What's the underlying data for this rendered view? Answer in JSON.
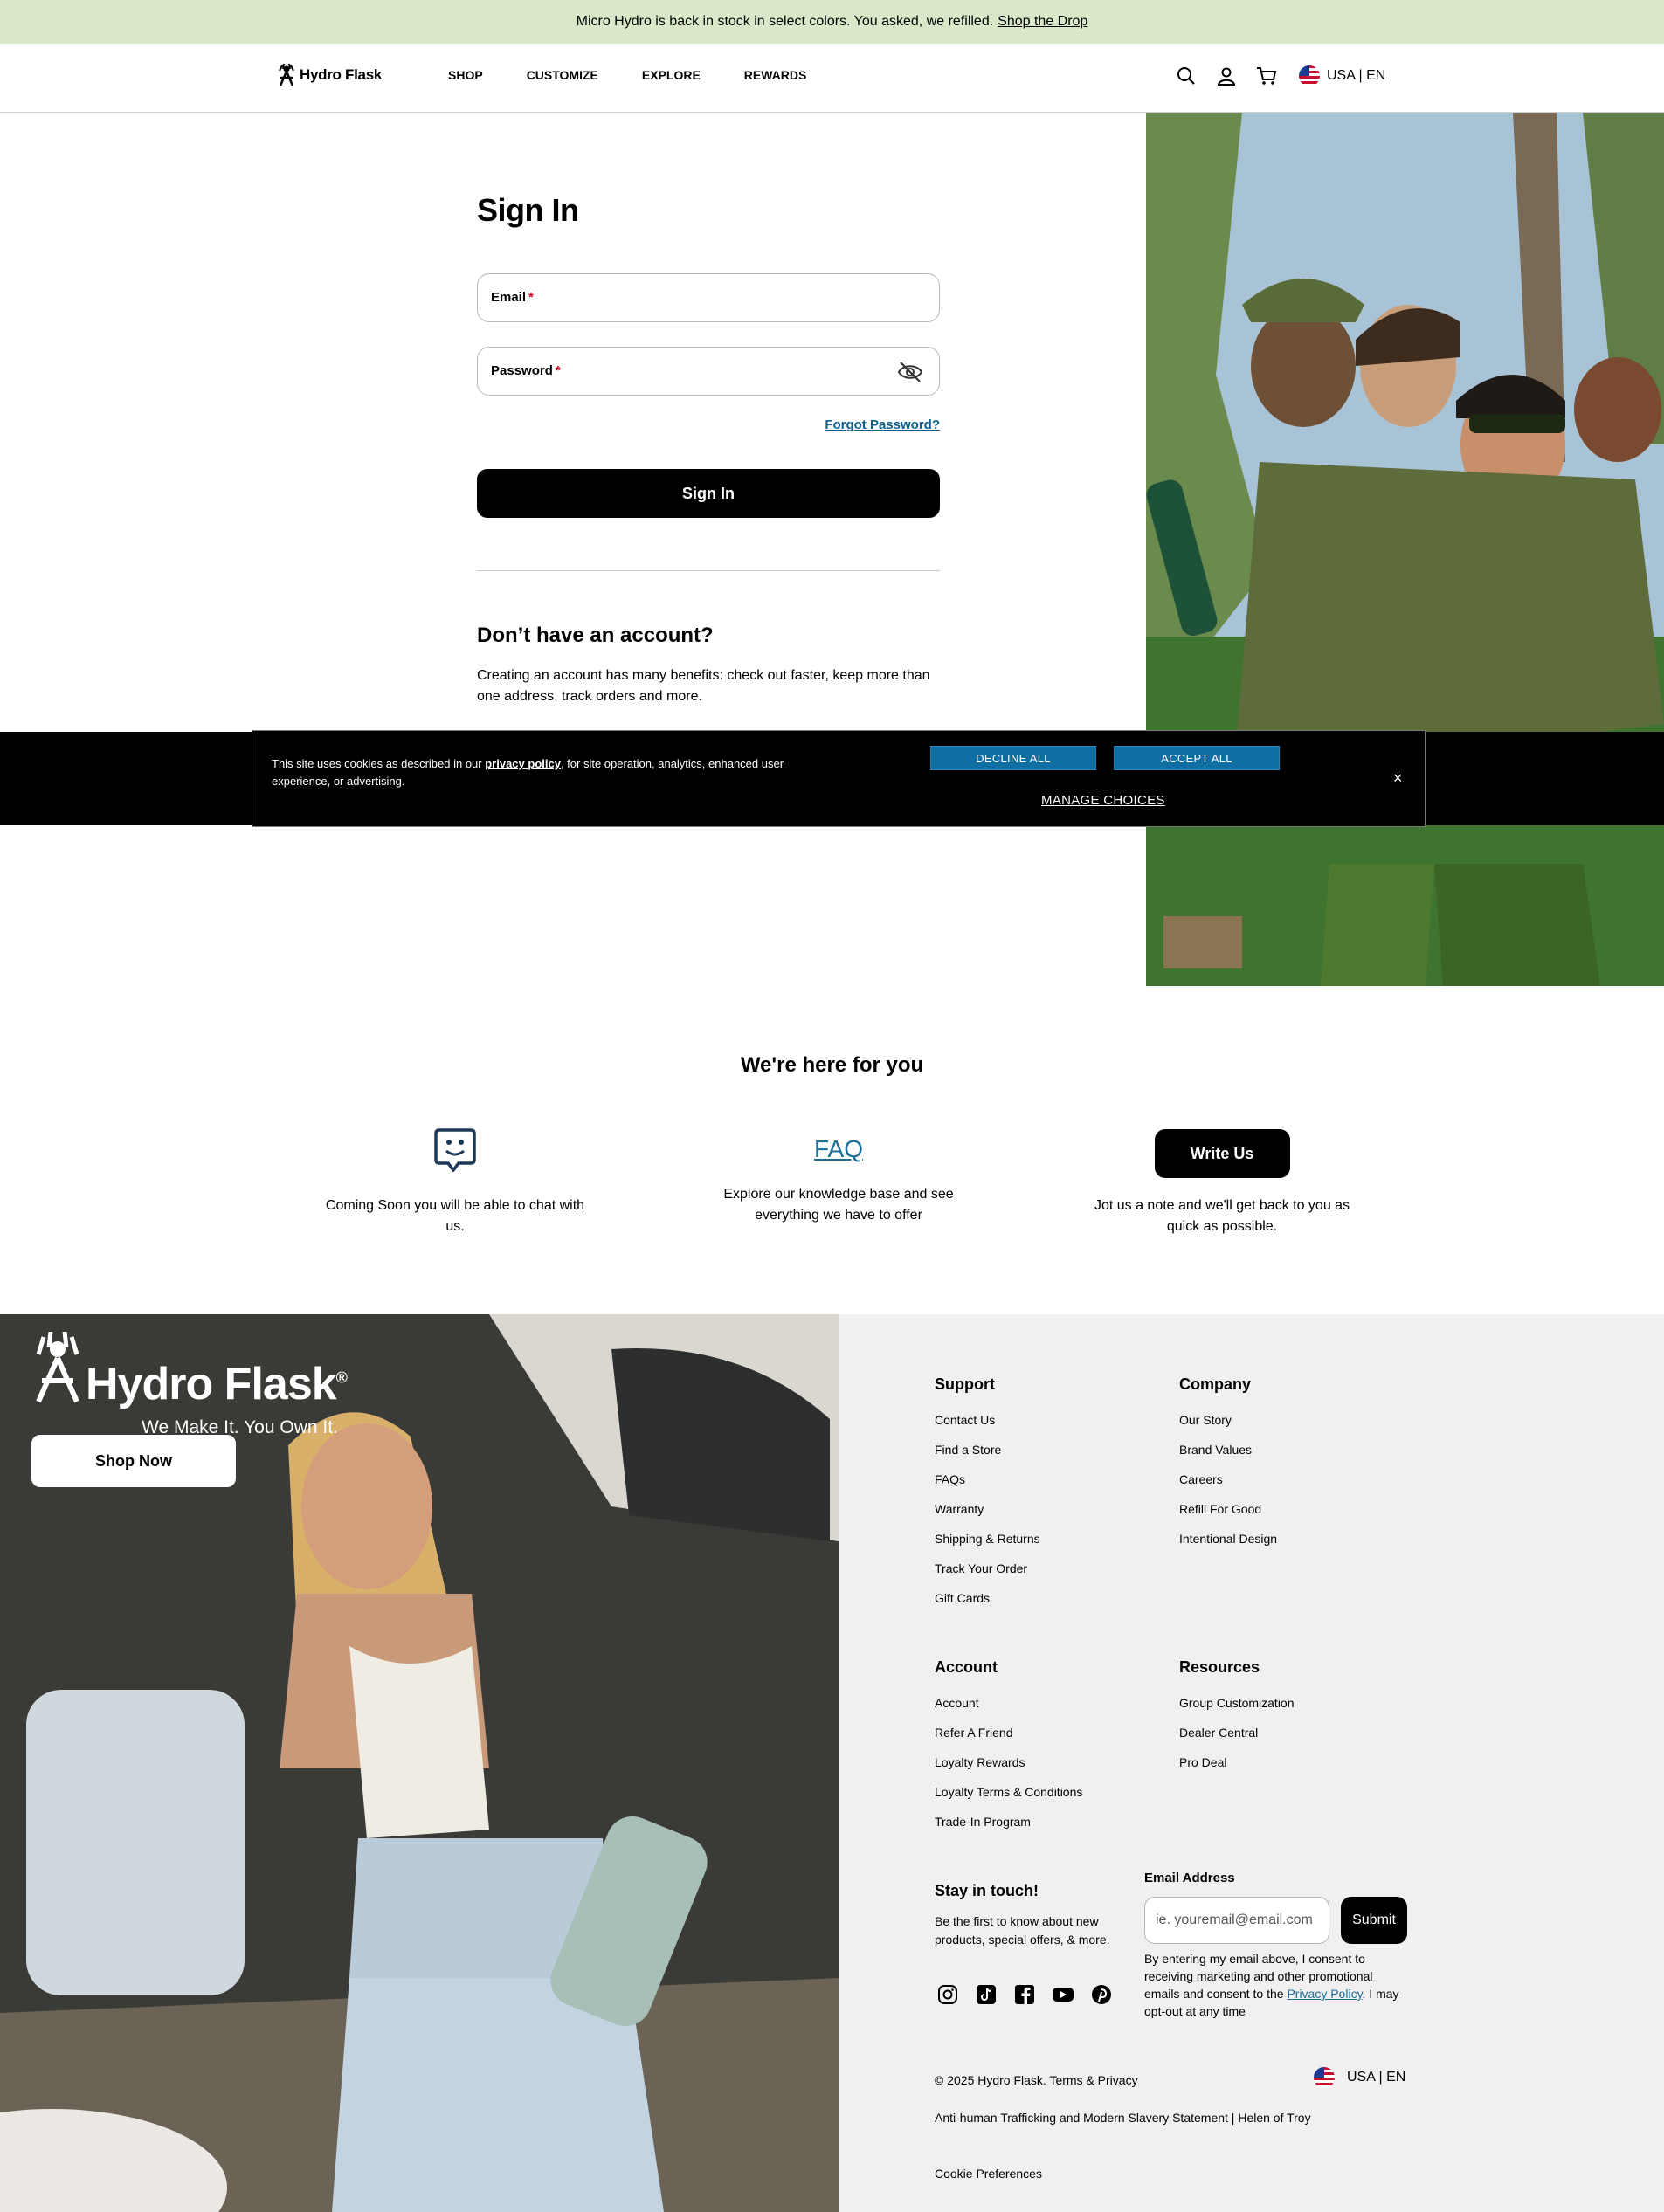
{
  "announcement": {
    "text": "Micro Hydro is back in stock in select colors. You asked, we refilled.",
    "link": "Shop the Drop"
  },
  "header": {
    "brand": "Hydro Flask",
    "nav": [
      "SHOP",
      "CUSTOMIZE",
      "EXPLORE",
      "REWARDS"
    ],
    "icons": [
      "search-icon",
      "account-icon",
      "cart-icon"
    ],
    "locale": "USA | EN"
  },
  "signin": {
    "title": "Sign In",
    "email_label": "Email",
    "password_label": "Password",
    "required_mark": "*",
    "forgot": "Forgot Password?",
    "button": "Sign In",
    "no_account_title": "Don’t have an account?",
    "no_account_desc": "Creating an account has many benefits: check out faster, keep more than one address, track orders and more."
  },
  "cookie": {
    "text_before": "This site uses cookies as described in our ",
    "policy_link": "privacy policy",
    "text_after": ", for site operation, analytics, enhanced user experience, or advertising.",
    "decline": "DECLINE ALL",
    "accept": "ACCEPT ALL",
    "manage": "MANAGE CHOICES",
    "close": "×"
  },
  "help": {
    "title": "We're here for you",
    "chat_desc": "Coming Soon you will be able to chat with us.",
    "faq_label": "FAQ",
    "faq_desc": "Explore our knowledge base and see everything we have to offer",
    "write_label": "Write Us",
    "write_desc": "Jot us a note and we'll get back to you as quick as possible."
  },
  "footer": {
    "brand": "Hydro Flask",
    "registered": "®",
    "tagline": "We Make It. You Own It.",
    "shop_now": "Shop Now",
    "support": {
      "title": "Support",
      "links": [
        "Contact Us",
        "Find a Store",
        "FAQs",
        "Warranty",
        "Shipping & Returns",
        "Track Your Order",
        "Gift Cards"
      ]
    },
    "company": {
      "title": "Company",
      "links": [
        "Our Story",
        "Brand Values",
        "Careers",
        "Refill For Good",
        "Intentional Design"
      ]
    },
    "account": {
      "title": "Account",
      "links": [
        "Account",
        "Refer A Friend",
        "Loyalty Rewards",
        "Loyalty Terms & Conditions",
        "Trade-In Program"
      ]
    },
    "resources": {
      "title": "Resources",
      "links": [
        "Group Customization",
        "Dealer Central",
        "Pro Deal"
      ]
    },
    "stay_title": "Stay in touch!",
    "stay_desc": "Be the first to know about new products, special offers, & more.",
    "social": [
      "instagram-icon",
      "tiktok-icon",
      "facebook-icon",
      "youtube-icon",
      "pinterest-icon"
    ],
    "email_label": "Email Address",
    "email_placeholder": "ie. youremail@email.com",
    "submit": "Submit",
    "consent_before": "By entering my email above, I consent to receiving marketing and other promotional emails and consent to the ",
    "consent_link": "Privacy Policy",
    "consent_after": ". I may opt-out at any time",
    "copyright": "© 2025 Hydro Flask. Terms & Privacy",
    "locale": "USA | EN",
    "legal": "Anti-human Trafficking and Modern Slavery Statement | Helen of Troy",
    "cookie_prefs": "Cookie Preferences"
  }
}
